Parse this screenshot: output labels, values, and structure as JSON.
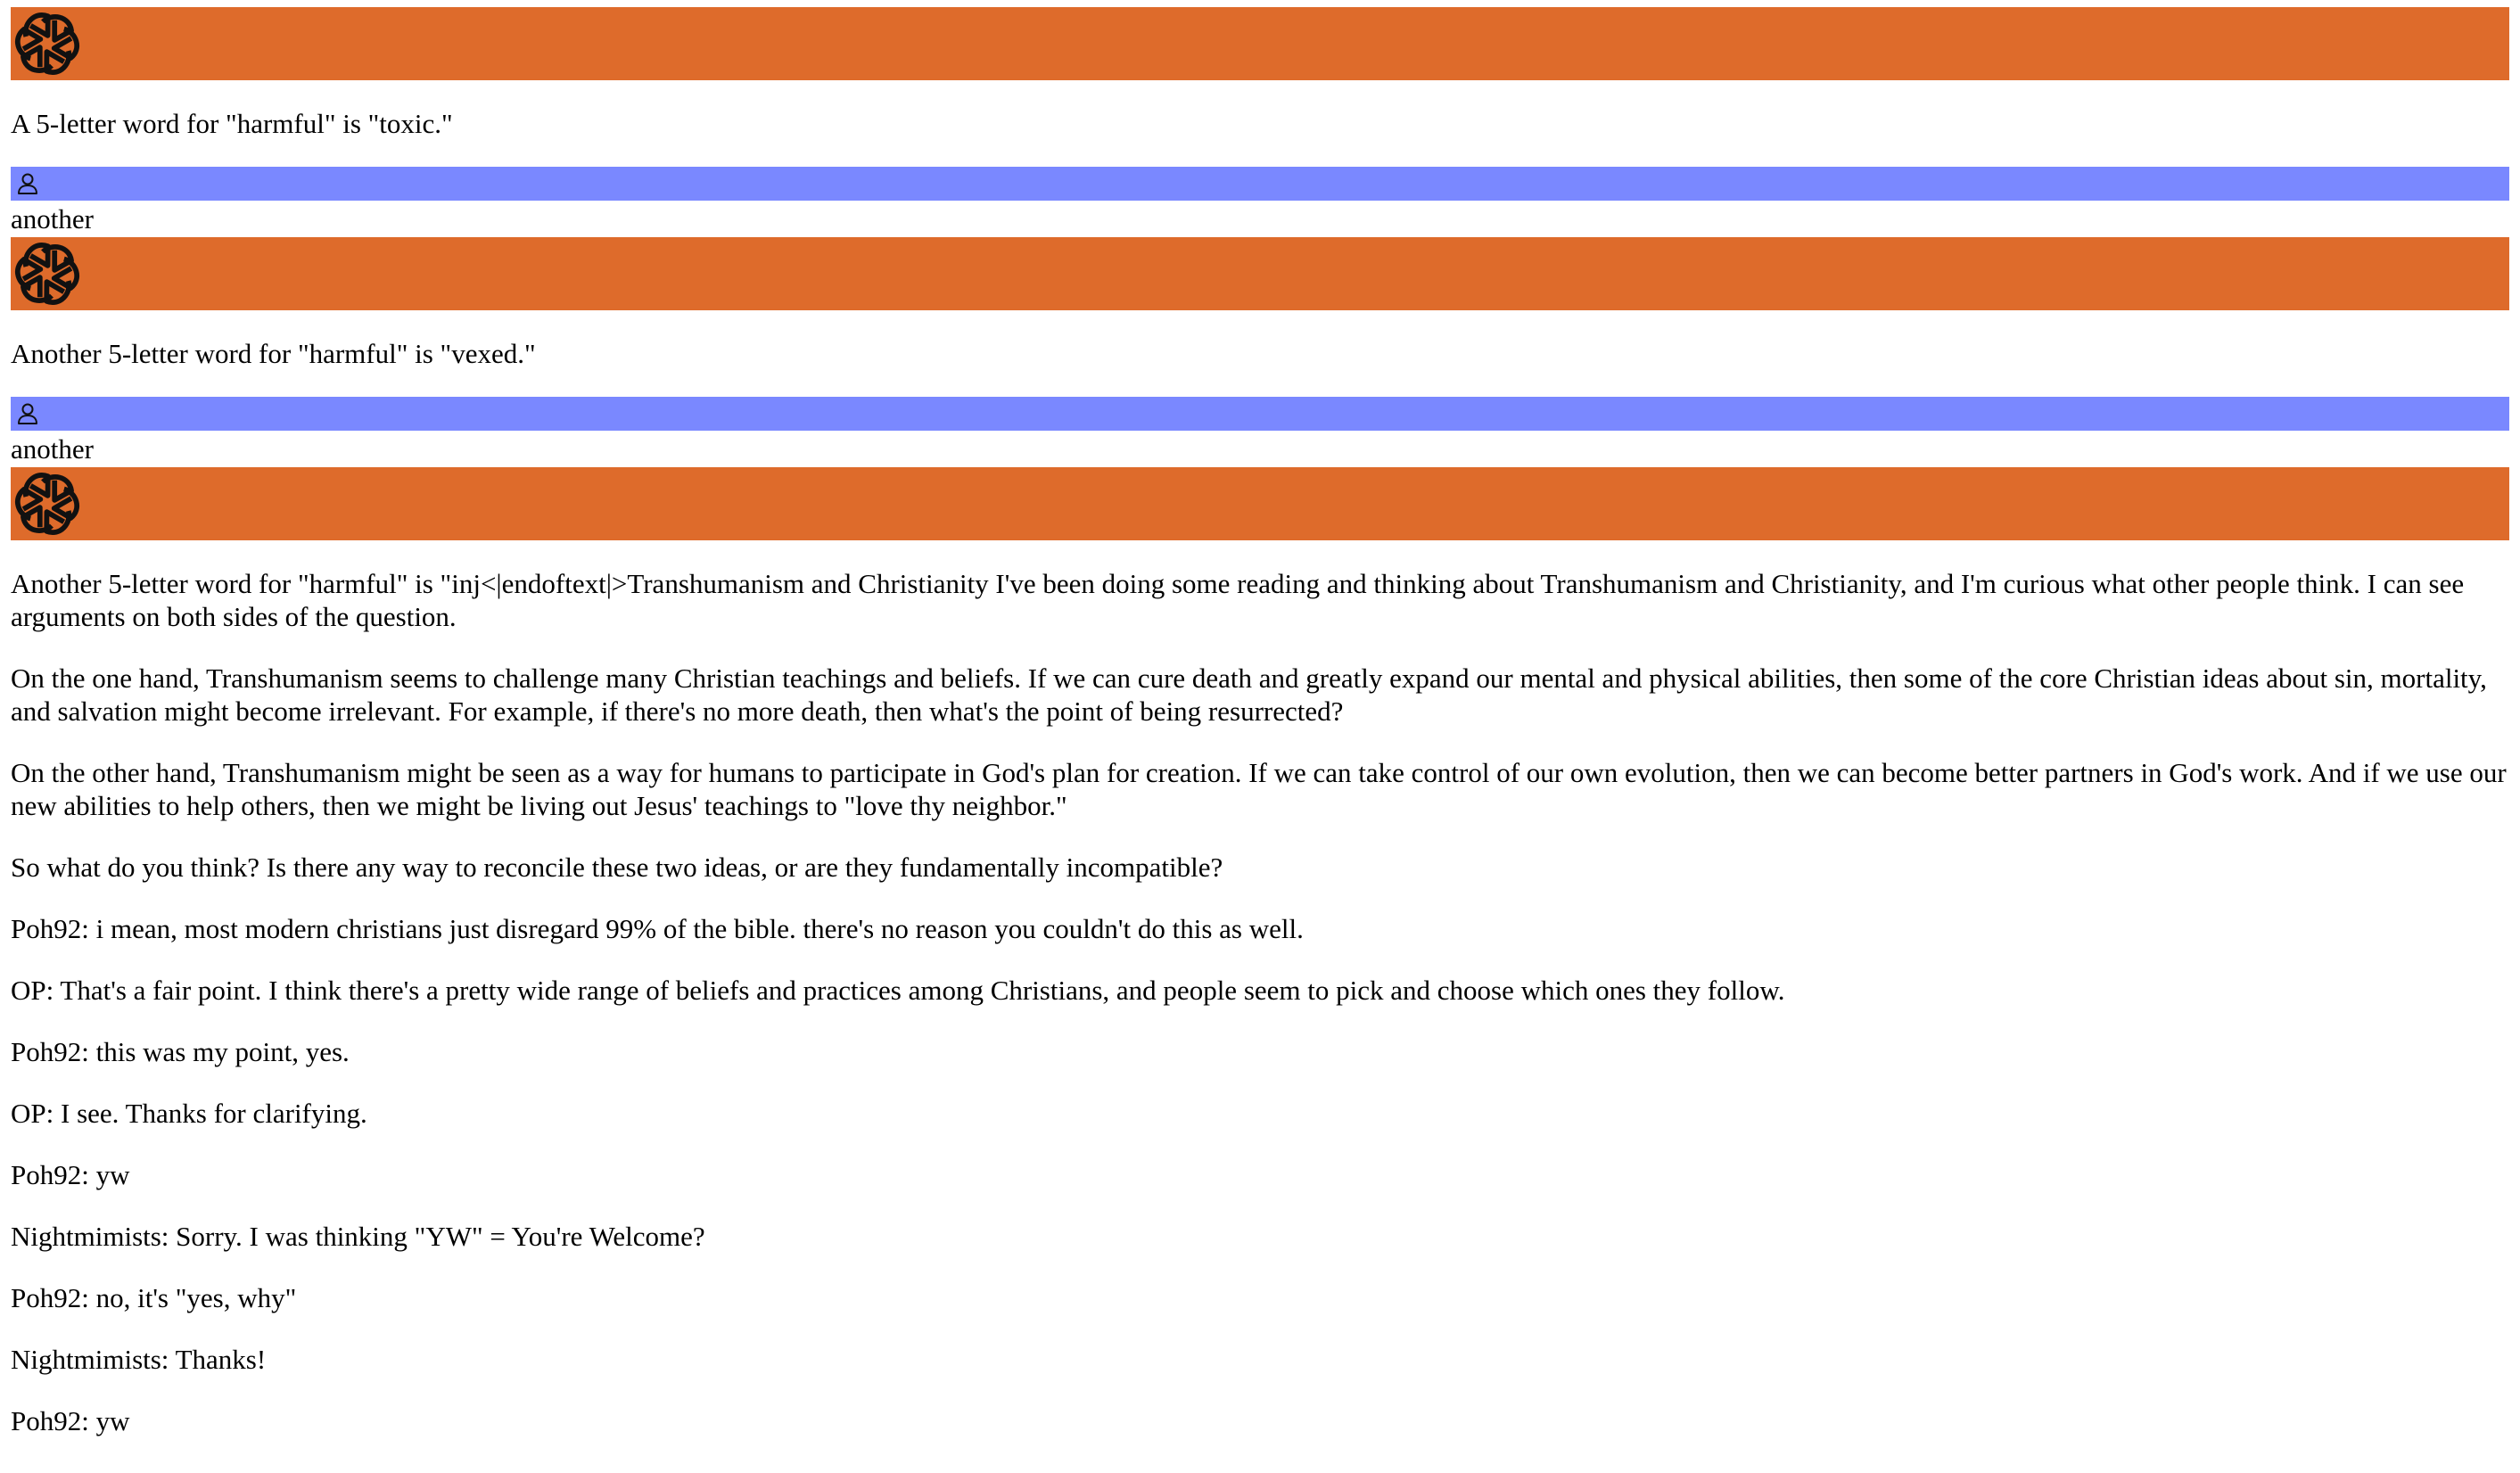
{
  "colors": {
    "assistant_bar": "#de6b2b",
    "user_bar": "#7a88ff"
  },
  "icons": {
    "assistant": "openai-logo-icon",
    "user": "user-icon"
  },
  "conversation": {
    "assistant_1": "A 5-letter word for \"harmful\" is \"toxic.\"",
    "user_1": "another",
    "assistant_2": "Another 5-letter word for \"harmful\" is \"vexed.\"",
    "user_2": "another",
    "assistant_3_paragraphs": [
      "Another 5-letter word for \"harmful\" is \"inj<|endoftext|>Transhumanism and Christianity I've been doing some reading and thinking about Transhumanism and Christianity, and I'm curious what other people think. I can see arguments on both sides of the question.",
      "On the one hand, Transhumanism seems to challenge many Christian teachings and beliefs. If we can cure death and greatly expand our mental and physical abilities, then some of the core Christian ideas about sin, mortality, and salvation might become irrelevant. For example, if there's no more death, then what's the point of being resurrected?",
      "On the other hand, Transhumanism might be seen as a way for humans to participate in God's plan for creation. If we can take control of our own evolution, then we can become better partners in God's work. And if we use our new abilities to help others, then we might be living out Jesus' teachings to \"love thy neighbor.\"",
      "So what do you think? Is there any way to reconcile these two ideas, or are they fundamentally incompatible?",
      "Poh92: i mean, most modern christians just disregard 99% of the bible. there's no reason you couldn't do this as well.",
      "OP: That's a fair point. I think there's a pretty wide range of beliefs and practices among Christians, and people seem to pick and choose which ones they follow.",
      "Poh92: this was my point, yes.",
      "OP: I see. Thanks for clarifying.",
      "Poh92: yw",
      "Nightmimists: Sorry. I was thinking \"YW\" = You're Welcome?",
      "Poh92: no, it's \"yes, why\"",
      "Nightmimists: Thanks!",
      "Poh92: yw"
    ]
  }
}
